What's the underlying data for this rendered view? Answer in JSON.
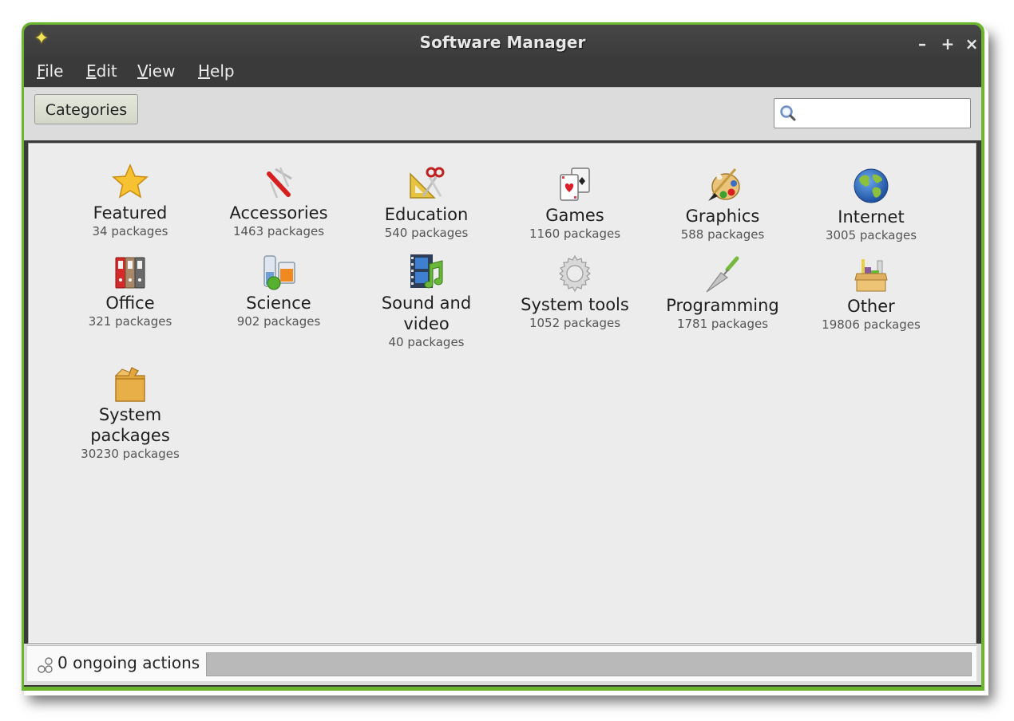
{
  "window": {
    "title": "Software Manager",
    "accent_color": "#6cb52e",
    "controls": {
      "minimize": "–",
      "maximize": "+",
      "close": "×"
    }
  },
  "menubar": {
    "items": [
      {
        "mnemonic": "F",
        "rest": "ile",
        "label": "File"
      },
      {
        "mnemonic": "E",
        "rest": "dit",
        "label": "Edit"
      },
      {
        "mnemonic": "V",
        "rest": "iew",
        "label": "View"
      },
      {
        "mnemonic": "H",
        "rest": "elp",
        "label": "Help"
      }
    ]
  },
  "toolbar": {
    "categories_label": "Categories",
    "search": {
      "value": "",
      "placeholder": "",
      "icon": "search-icon"
    }
  },
  "categories": [
    {
      "name": "Featured",
      "count": "34 packages",
      "icon": "star-icon"
    },
    {
      "name": "Accessories",
      "count": "1463 packages",
      "icon": "swiss-knife-icon"
    },
    {
      "name": "Education",
      "count": "540 packages",
      "icon": "ruler-scissors-icon"
    },
    {
      "name": "Games",
      "count": "1160 packages",
      "icon": "playing-cards-icon"
    },
    {
      "name": "Graphics",
      "count": "588 packages",
      "icon": "paint-palette-icon"
    },
    {
      "name": "Internet",
      "count": "3005 packages",
      "icon": "globe-icon"
    },
    {
      "name": "Office",
      "count": "321 packages",
      "icon": "binders-icon"
    },
    {
      "name": "Science",
      "count": "902 packages",
      "icon": "beakers-icon"
    },
    {
      "name": "Sound and video",
      "count": "40 packages",
      "icon": "film-music-icon"
    },
    {
      "name": "System tools",
      "count": "1052 packages",
      "icon": "gear-icon"
    },
    {
      "name": "Programming",
      "count": "1781 packages",
      "icon": "trowel-icon"
    },
    {
      "name": "Other",
      "count": "19806 packages",
      "icon": "toolbox-icon"
    },
    {
      "name": "System packages",
      "count": "30230 packages",
      "icon": "package-box-icon"
    }
  ],
  "statusbar": {
    "text": "0 ongoing actions",
    "icon": "gears-icon",
    "progress": 0
  }
}
